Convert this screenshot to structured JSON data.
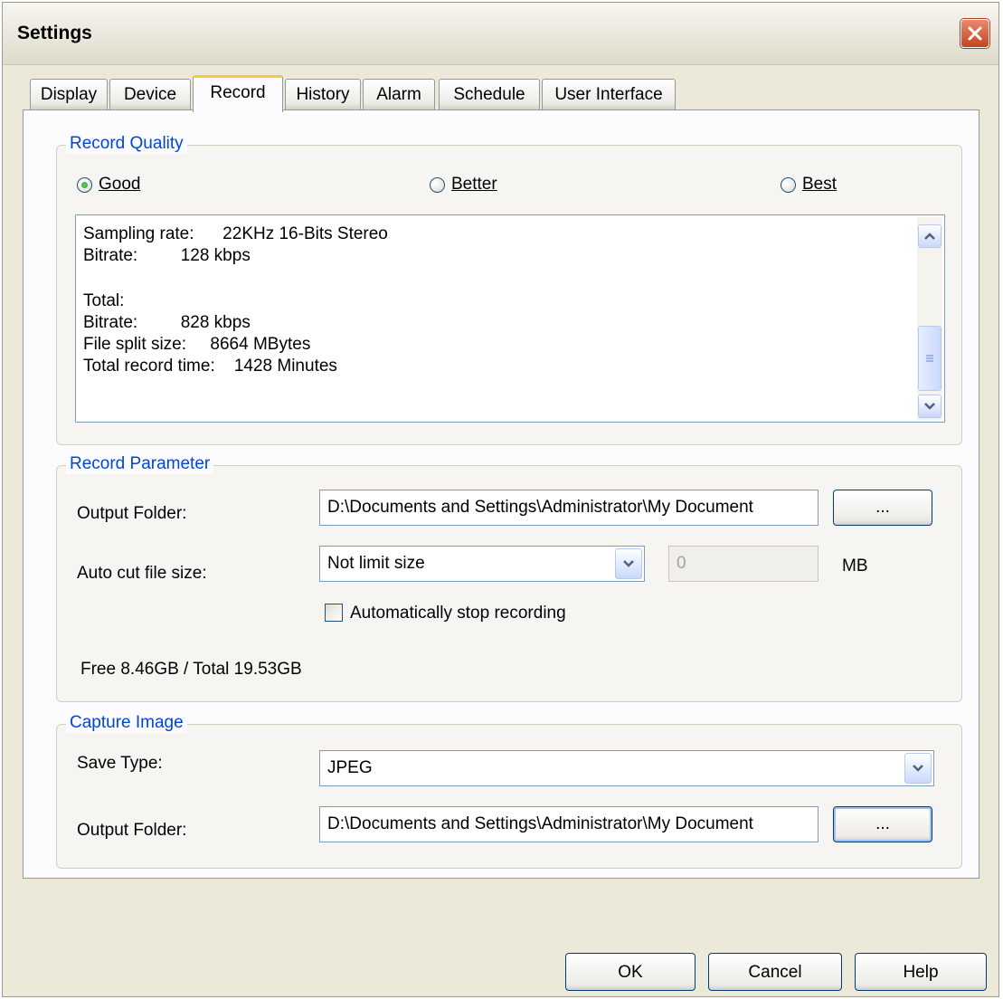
{
  "window": {
    "title": "Settings"
  },
  "tabs": [
    {
      "label": "Display"
    },
    {
      "label": "Device"
    },
    {
      "label": "Record"
    },
    {
      "label": "History"
    },
    {
      "label": "Alarm"
    },
    {
      "label": "Schedule"
    },
    {
      "label": "User Interface"
    }
  ],
  "active_tab": "Record",
  "record_quality": {
    "legend": "Record Quality",
    "options": [
      {
        "label": "Good",
        "selected": true
      },
      {
        "label": "Better",
        "selected": false
      },
      {
        "label": "Best",
        "selected": false
      }
    ],
    "info_lines": [
      "Sampling rate:      22KHz 16-Bits Stereo",
      "Bitrate:         128 kbps",
      "",
      "Total:",
      "Bitrate:         828 kbps",
      "File split size:     8664 MBytes",
      "Total record time:    1428 Minutes"
    ]
  },
  "record_parameter": {
    "legend": "Record Parameter",
    "output_folder_label": "Output Folder:",
    "output_folder_value": "D:\\Documents and Settings\\Administrator\\My Document",
    "browse_label": "...",
    "auto_cut_label": "Auto cut file size:",
    "auto_cut_value": "Not limit size",
    "size_value": "0",
    "size_unit": "MB",
    "auto_stop_label": "Automatically stop recording",
    "auto_stop_checked": false,
    "free_space": "Free 8.46GB / Total 19.53GB"
  },
  "capture_image": {
    "legend": "Capture Image",
    "save_type_label": "Save Type:",
    "save_type_value": "JPEG",
    "output_folder_label": "Output Folder:",
    "output_folder_value": "D:\\Documents and Settings\\Administrator\\My Document",
    "browse_label": "..."
  },
  "footer": {
    "ok": "OK",
    "cancel": "Cancel",
    "help": "Help"
  },
  "colors": {
    "dialog_bg": "#ece9d8",
    "legend_text": "#0046d5",
    "close_red": "#c7441f",
    "tab_highlight": "#ffc83c"
  }
}
